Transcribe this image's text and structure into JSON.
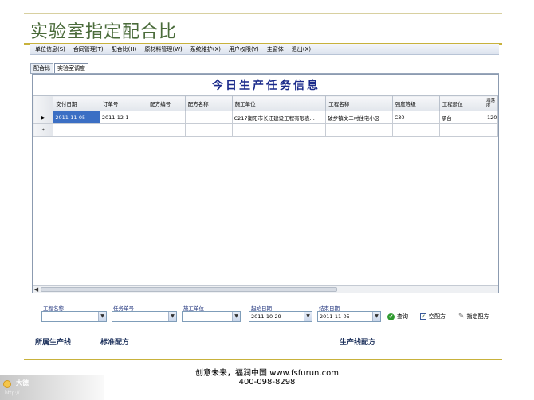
{
  "slide": {
    "title": "实验室指定配合比",
    "footer_line1": "创意未来，福润中国 www.fsfurun.com",
    "footer_line2": "400-098-8298"
  },
  "watermark": {
    "text": "大德",
    "url": "http://"
  },
  "menubar": {
    "items": [
      "单位信息(S)",
      "合同管理(T)",
      "配合比(H)",
      "原材料管理(W)",
      "系统维护(X)",
      "用户权限(Y)",
      "主窗体",
      "退出(X)"
    ]
  },
  "tabs": [
    {
      "label": "配合比",
      "active": false
    },
    {
      "label": "实验室调度",
      "active": true
    }
  ],
  "grid": {
    "title": "今日生产任务信息",
    "columns": [
      "交付日期",
      "订单号",
      "配方编号",
      "配方名称",
      "施工单位",
      "工程名称",
      "强度等级",
      "工程部位",
      "塌落度"
    ],
    "rows": [
      {
        "indicator": "▶",
        "cells": [
          "2011-11-05",
          "2011-12-1",
          "",
          "",
          "C217衡阳市长江建设工程有限表...",
          "破步镇文二村住宅小区",
          "C30",
          "承台",
          "120"
        ]
      },
      {
        "indicator": "*",
        "cells": [
          "",
          "",
          "",
          "",
          "",
          "",
          "",
          "",
          ""
        ]
      }
    ]
  },
  "filters": {
    "project_name": {
      "label": "工程名称",
      "value": ""
    },
    "task_no": {
      "label": "任务单号",
      "value": ""
    },
    "construction_unit": {
      "label": "施工单位",
      "value": ""
    },
    "start_date": {
      "label": "起始日期",
      "value": "2011-10-29"
    },
    "end_date": {
      "label": "结束日期",
      "value": "2011-11-05"
    },
    "query_label": "查询",
    "empty_mix_label": "空配方",
    "empty_mix_checked": true,
    "assign_mix_label": "指定配方"
  },
  "bottom": {
    "line_label": "所属生产线",
    "standard_label": "标准配方",
    "production_label": "生产线配方"
  },
  "colors": {
    "title": "#4a6b3a",
    "accent_line": "#c8b23c",
    "grid_title": "#1a2a8a",
    "selection": "#3b6fc4"
  }
}
